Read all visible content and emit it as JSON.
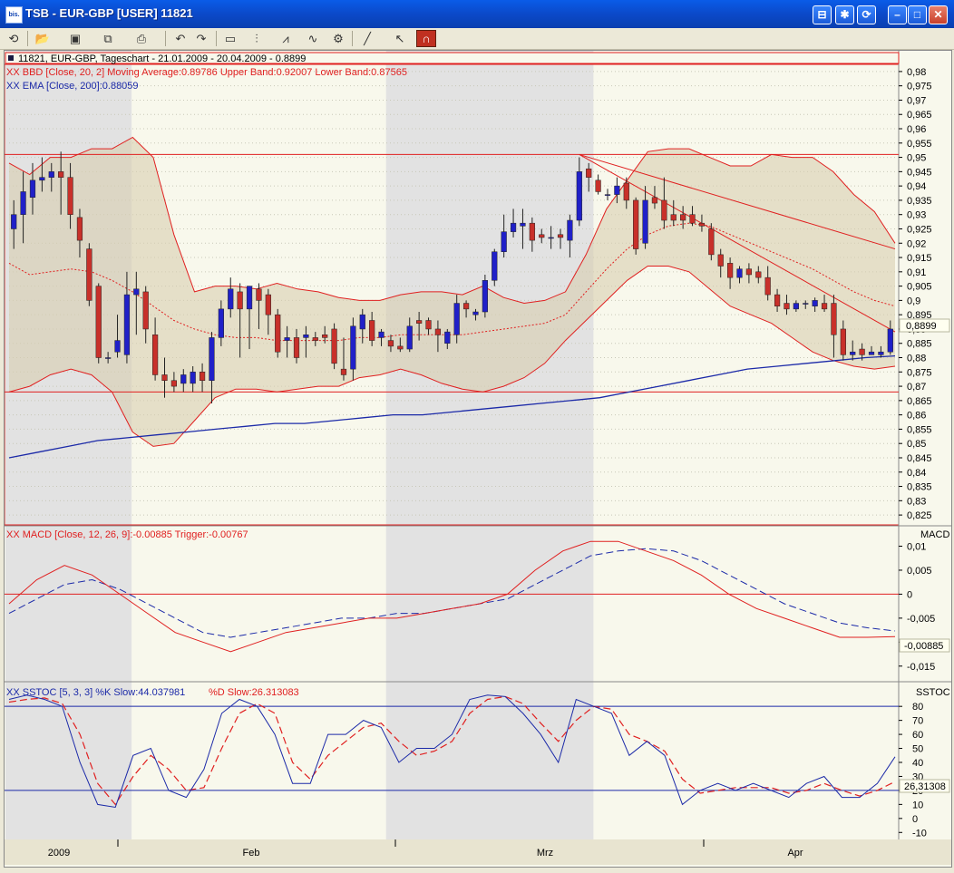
{
  "window": {
    "app_icon": "bis.",
    "title": "TSB - EUR-GBP [USER] 11821",
    "buttons": [
      "layout-icon",
      "star-icon",
      "refresh-icon",
      "minimize-icon",
      "maximize-icon",
      "close-icon"
    ]
  },
  "toolbar": {
    "tools": [
      "refresh-icon",
      "open-folder-icon",
      "save-icon",
      "copy-icon",
      "print-icon",
      "chart-back-icon",
      "chart-forward-icon",
      "window-icon",
      "candle-icon",
      "bar-style-icon",
      "indicator-icon",
      "properties-icon",
      "trendline-icon",
      "cursor-icon",
      "magnet-icon"
    ]
  },
  "colors": {
    "up_candle": "#2020c8",
    "down_candle": "#c8302a",
    "band_line": "#e02020",
    "ema_line": "#1c2aa8",
    "band_fill": "#d8ceb0",
    "shade": "#c8c8d8",
    "chart_bg": "#f8f8ec"
  },
  "price_panel": {
    "header": "11821, EUR-GBP, Tageschart - 21.01.2009 - 20.04.2009 - 0.8899",
    "legend_bbd": "XX BBD [Close, 20, 2] Moving Average:0.89786 Upper Band:0.92007 Lower Band:0.87565",
    "legend_ema": "XX EMA [Close, 200]:0.88059",
    "current_price_label": "0,8899",
    "y_ticks": [
      "0,98",
      "0,975",
      "0,97",
      "0,965",
      "0,96",
      "0,955",
      "0,95",
      "0,945",
      "0,94",
      "0,935",
      "0,93",
      "0,925",
      "0,92",
      "0,915",
      "0,91",
      "0,905",
      "0,9",
      "0,895",
      "0,89",
      "0,885",
      "0,88",
      "0,875",
      "0,87",
      "0,865",
      "0,86",
      "0,855",
      "0,85",
      "0,845",
      "0,84",
      "0,835",
      "0,83",
      "0,825"
    ]
  },
  "macd_panel": {
    "title": "MACD",
    "legend": "XX MACD [Close, 12, 26, 9]:-0.00885 Trigger:-0.00767",
    "value_label": "-0,00885",
    "y_ticks": [
      "0,01",
      "0,005",
      "0",
      "-0,005",
      "-0,01",
      "-0,015"
    ]
  },
  "sstoc_panel": {
    "title": "SSTOC",
    "legend_k": "XX SSTOC [5, 3, 3] %K Slow:44.037981",
    "legend_d": "%D Slow:26.313083",
    "value_label": "26,31308",
    "y_ticks": [
      "80",
      "70",
      "60",
      "50",
      "40",
      "30",
      "20",
      "10",
      "0",
      "-10"
    ]
  },
  "x_axis": {
    "labels": [
      "2009",
      "Feb",
      "Mrz",
      "Apr"
    ]
  },
  "chart_data": {
    "type": "candlestick",
    "symbol": "EUR-GBP",
    "period": "21.01.2009 - 20.04.2009",
    "ylim": [
      0.8225,
      0.9825
    ],
    "support_resistance": [
      0.951,
      0.868
    ],
    "candles": [
      {
        "o": 0.925,
        "h": 0.935,
        "l": 0.918,
        "c": 0.93
      },
      {
        "o": 0.93,
        "h": 0.945,
        "l": 0.92,
        "c": 0.938
      },
      {
        "o": 0.936,
        "h": 0.948,
        "l": 0.93,
        "c": 0.942
      },
      {
        "o": 0.942,
        "h": 0.95,
        "l": 0.938,
        "c": 0.943
      },
      {
        "o": 0.943,
        "h": 0.948,
        "l": 0.938,
        "c": 0.945
      },
      {
        "o": 0.945,
        "h": 0.952,
        "l": 0.93,
        "c": 0.943
      },
      {
        "o": 0.943,
        "h": 0.948,
        "l": 0.925,
        "c": 0.93
      },
      {
        "o": 0.929,
        "h": 0.932,
        "l": 0.915,
        "c": 0.921
      },
      {
        "o": 0.918,
        "h": 0.92,
        "l": 0.898,
        "c": 0.9
      },
      {
        "o": 0.905,
        "h": 0.906,
        "l": 0.878,
        "c": 0.88
      },
      {
        "o": 0.88,
        "h": 0.882,
        "l": 0.878,
        "c": 0.88
      },
      {
        "o": 0.882,
        "h": 0.895,
        "l": 0.88,
        "c": 0.886
      },
      {
        "o": 0.881,
        "h": 0.91,
        "l": 0.878,
        "c": 0.902
      },
      {
        "o": 0.902,
        "h": 0.91,
        "l": 0.888,
        "c": 0.904
      },
      {
        "o": 0.903,
        "h": 0.905,
        "l": 0.885,
        "c": 0.89
      },
      {
        "o": 0.888,
        "h": 0.894,
        "l": 0.872,
        "c": 0.874
      },
      {
        "o": 0.874,
        "h": 0.88,
        "l": 0.866,
        "c": 0.872
      },
      {
        "o": 0.872,
        "h": 0.875,
        "l": 0.868,
        "c": 0.87
      },
      {
        "o": 0.871,
        "h": 0.876,
        "l": 0.868,
        "c": 0.874
      },
      {
        "o": 0.871,
        "h": 0.877,
        "l": 0.868,
        "c": 0.875
      },
      {
        "o": 0.875,
        "h": 0.878,
        "l": 0.868,
        "c": 0.872
      },
      {
        "o": 0.872,
        "h": 0.889,
        "l": 0.864,
        "c": 0.887
      },
      {
        "o": 0.887,
        "h": 0.9,
        "l": 0.884,
        "c": 0.897
      },
      {
        "o": 0.897,
        "h": 0.908,
        "l": 0.894,
        "c": 0.904
      },
      {
        "o": 0.903,
        "h": 0.906,
        "l": 0.88,
        "c": 0.897
      },
      {
        "o": 0.897,
        "h": 0.905,
        "l": 0.883,
        "c": 0.905
      },
      {
        "o": 0.904,
        "h": 0.906,
        "l": 0.89,
        "c": 0.9
      },
      {
        "o": 0.902,
        "h": 0.904,
        "l": 0.888,
        "c": 0.895
      },
      {
        "o": 0.895,
        "h": 0.897,
        "l": 0.88,
        "c": 0.882
      },
      {
        "o": 0.886,
        "h": 0.891,
        "l": 0.88,
        "c": 0.887
      },
      {
        "o": 0.887,
        "h": 0.89,
        "l": 0.878,
        "c": 0.88
      },
      {
        "o": 0.887,
        "h": 0.891,
        "l": 0.88,
        "c": 0.888
      },
      {
        "o": 0.887,
        "h": 0.889,
        "l": 0.884,
        "c": 0.886
      },
      {
        "o": 0.888,
        "h": 0.891,
        "l": 0.885,
        "c": 0.887
      },
      {
        "o": 0.89,
        "h": 0.892,
        "l": 0.876,
        "c": 0.878
      },
      {
        "o": 0.876,
        "h": 0.887,
        "l": 0.872,
        "c": 0.874
      },
      {
        "o": 0.876,
        "h": 0.894,
        "l": 0.872,
        "c": 0.891
      },
      {
        "o": 0.89,
        "h": 0.897,
        "l": 0.885,
        "c": 0.895
      },
      {
        "o": 0.893,
        "h": 0.896,
        "l": 0.884,
        "c": 0.886
      },
      {
        "o": 0.887,
        "h": 0.89,
        "l": 0.884,
        "c": 0.889
      },
      {
        "o": 0.886,
        "h": 0.888,
        "l": 0.882,
        "c": 0.884
      },
      {
        "o": 0.884,
        "h": 0.887,
        "l": 0.882,
        "c": 0.883
      },
      {
        "o": 0.883,
        "h": 0.894,
        "l": 0.882,
        "c": 0.891
      },
      {
        "o": 0.893,
        "h": 0.896,
        "l": 0.886,
        "c": 0.892
      },
      {
        "o": 0.893,
        "h": 0.894,
        "l": 0.888,
        "c": 0.89
      },
      {
        "o": 0.89,
        "h": 0.893,
        "l": 0.882,
        "c": 0.888
      },
      {
        "o": 0.885,
        "h": 0.89,
        "l": 0.883,
        "c": 0.889
      },
      {
        "o": 0.888,
        "h": 0.902,
        "l": 0.885,
        "c": 0.899
      },
      {
        "o": 0.899,
        "h": 0.9,
        "l": 0.894,
        "c": 0.897
      },
      {
        "o": 0.895,
        "h": 0.897,
        "l": 0.893,
        "c": 0.896
      },
      {
        "o": 0.896,
        "h": 0.909,
        "l": 0.894,
        "c": 0.907
      },
      {
        "o": 0.907,
        "h": 0.918,
        "l": 0.905,
        "c": 0.917
      },
      {
        "o": 0.917,
        "h": 0.93,
        "l": 0.915,
        "c": 0.924
      },
      {
        "o": 0.924,
        "h": 0.932,
        "l": 0.922,
        "c": 0.927
      },
      {
        "o": 0.926,
        "h": 0.932,
        "l": 0.918,
        "c": 0.927
      },
      {
        "o": 0.927,
        "h": 0.929,
        "l": 0.917,
        "c": 0.921
      },
      {
        "o": 0.923,
        "h": 0.925,
        "l": 0.92,
        "c": 0.922
      },
      {
        "o": 0.922,
        "h": 0.926,
        "l": 0.918,
        "c": 0.922
      },
      {
        "o": 0.923,
        "h": 0.925,
        "l": 0.918,
        "c": 0.922
      },
      {
        "o": 0.921,
        "h": 0.93,
        "l": 0.915,
        "c": 0.928
      },
      {
        "o": 0.928,
        "h": 0.95,
        "l": 0.926,
        "c": 0.945
      },
      {
        "o": 0.946,
        "h": 0.948,
        "l": 0.938,
        "c": 0.943
      },
      {
        "o": 0.942,
        "h": 0.944,
        "l": 0.937,
        "c": 0.938
      },
      {
        "o": 0.937,
        "h": 0.939,
        "l": 0.935,
        "c": 0.937
      },
      {
        "o": 0.937,
        "h": 0.943,
        "l": 0.934,
        "c": 0.94
      },
      {
        "o": 0.941,
        "h": 0.943,
        "l": 0.932,
        "c": 0.935
      },
      {
        "o": 0.935,
        "h": 0.936,
        "l": 0.916,
        "c": 0.918
      },
      {
        "o": 0.92,
        "h": 0.94,
        "l": 0.918,
        "c": 0.935
      },
      {
        "o": 0.936,
        "h": 0.94,
        "l": 0.932,
        "c": 0.934
      },
      {
        "o": 0.935,
        "h": 0.943,
        "l": 0.925,
        "c": 0.928
      },
      {
        "o": 0.93,
        "h": 0.935,
        "l": 0.926,
        "c": 0.928
      },
      {
        "o": 0.93,
        "h": 0.933,
        "l": 0.925,
        "c": 0.928
      },
      {
        "o": 0.93,
        "h": 0.933,
        "l": 0.926,
        "c": 0.927
      },
      {
        "o": 0.927,
        "h": 0.93,
        "l": 0.924,
        "c": 0.926
      },
      {
        "o": 0.925,
        "h": 0.927,
        "l": 0.914,
        "c": 0.916
      },
      {
        "o": 0.916,
        "h": 0.918,
        "l": 0.908,
        "c": 0.912
      },
      {
        "o": 0.913,
        "h": 0.915,
        "l": 0.904,
        "c": 0.908
      },
      {
        "o": 0.908,
        "h": 0.912,
        "l": 0.906,
        "c": 0.911
      },
      {
        "o": 0.911,
        "h": 0.913,
        "l": 0.906,
        "c": 0.909
      },
      {
        "o": 0.91,
        "h": 0.912,
        "l": 0.906,
        "c": 0.908
      },
      {
        "o": 0.908,
        "h": 0.912,
        "l": 0.9,
        "c": 0.902
      },
      {
        "o": 0.902,
        "h": 0.904,
        "l": 0.896,
        "c": 0.898
      },
      {
        "o": 0.899,
        "h": 0.902,
        "l": 0.895,
        "c": 0.897
      },
      {
        "o": 0.897,
        "h": 0.9,
        "l": 0.896,
        "c": 0.899
      },
      {
        "o": 0.899,
        "h": 0.9,
        "l": 0.897,
        "c": 0.899
      },
      {
        "o": 0.898,
        "h": 0.901,
        "l": 0.896,
        "c": 0.9
      },
      {
        "o": 0.899,
        "h": 0.902,
        "l": 0.896,
        "c": 0.897
      },
      {
        "o": 0.899,
        "h": 0.902,
        "l": 0.88,
        "c": 0.888
      },
      {
        "o": 0.89,
        "h": 0.893,
        "l": 0.879,
        "c": 0.881
      },
      {
        "o": 0.881,
        "h": 0.886,
        "l": 0.879,
        "c": 0.882
      },
      {
        "o": 0.883,
        "h": 0.885,
        "l": 0.879,
        "c": 0.881
      },
      {
        "o": 0.881,
        "h": 0.884,
        "l": 0.881,
        "c": 0.882
      },
      {
        "o": 0.881,
        "h": 0.884,
        "l": 0.88,
        "c": 0.882
      },
      {
        "o": 0.882,
        "h": 0.893,
        "l": 0.881,
        "c": 0.89
      }
    ],
    "ema_200": [
      0.845,
      0.847,
      0.849,
      0.851,
      0.852,
      0.853,
      0.854,
      0.855,
      0.856,
      0.857,
      0.857,
      0.858,
      0.859,
      0.86,
      0.86,
      0.861,
      0.862,
      0.863,
      0.864,
      0.865,
      0.866,
      0.868,
      0.87,
      0.872,
      0.874,
      0.876,
      0.877,
      0.878,
      0.879,
      0.88,
      0.8806
    ],
    "bbd_upper": [
      0.948,
      0.944,
      0.95,
      0.95,
      0.953,
      0.953,
      0.957,
      0.95,
      0.923,
      0.903,
      0.905,
      0.905,
      0.904,
      0.906,
      0.904,
      0.903,
      0.901,
      0.9,
      0.9,
      0.902,
      0.903,
      0.903,
      0.902,
      0.905,
      0.901,
      0.899,
      0.9,
      0.903,
      0.916,
      0.932,
      0.942,
      0.952,
      0.953,
      0.953,
      0.95,
      0.947,
      0.947,
      0.951,
      0.95,
      0.95,
      0.945,
      0.937,
      0.931,
      0.92
    ],
    "bbd_lower": [
      0.868,
      0.87,
      0.874,
      0.876,
      0.874,
      0.868,
      0.854,
      0.849,
      0.85,
      0.858,
      0.866,
      0.869,
      0.869,
      0.868,
      0.869,
      0.87,
      0.87,
      0.873,
      0.874,
      0.876,
      0.874,
      0.871,
      0.869,
      0.868,
      0.87,
      0.873,
      0.878,
      0.886,
      0.893,
      0.9,
      0.907,
      0.912,
      0.912,
      0.91,
      0.904,
      0.898,
      0.895,
      0.892,
      0.887,
      0.882,
      0.879,
      0.877,
      0.876,
      0.877
    ],
    "bbd_ma": [
      0.913,
      0.909,
      0.91,
      0.911,
      0.91,
      0.907,
      0.903,
      0.898,
      0.893,
      0.89,
      0.888,
      0.887,
      0.887,
      0.886,
      0.886,
      0.886,
      0.886,
      0.887,
      0.887,
      0.888,
      0.888,
      0.888,
      0.888,
      0.889,
      0.89,
      0.891,
      0.892,
      0.895,
      0.903,
      0.911,
      0.918,
      0.923,
      0.926,
      0.927,
      0.926,
      0.923,
      0.92,
      0.917,
      0.914,
      0.911,
      0.907,
      0.903,
      0.9,
      0.898
    ],
    "macd": [
      -0.002,
      0.003,
      0.006,
      0.004,
      0.0,
      -0.004,
      -0.008,
      -0.01,
      -0.012,
      -0.01,
      -0.008,
      -0.007,
      -0.006,
      -0.005,
      -0.005,
      -0.004,
      -0.003,
      -0.002,
      0.0,
      0.005,
      0.009,
      0.011,
      0.011,
      0.009,
      0.007,
      0.004,
      0.0,
      -0.003,
      -0.005,
      -0.007,
      -0.009,
      -0.009,
      -0.00885
    ],
    "macd_trigger": [
      -0.004,
      -0.001,
      0.002,
      0.003,
      0.001,
      -0.002,
      -0.005,
      -0.008,
      -0.009,
      -0.008,
      -0.007,
      -0.006,
      -0.005,
      -0.005,
      -0.004,
      -0.004,
      -0.003,
      -0.002,
      -0.001,
      0.002,
      0.005,
      0.008,
      0.009,
      0.0095,
      0.009,
      0.007,
      0.004,
      0.001,
      -0.002,
      -0.004,
      -0.006,
      -0.007,
      -0.00767
    ],
    "sstoc_k": [
      85,
      88,
      85,
      80,
      40,
      10,
      8,
      45,
      50,
      20,
      15,
      35,
      75,
      85,
      80,
      60,
      25,
      25,
      60,
      60,
      70,
      65,
      40,
      50,
      50,
      60,
      85,
      88,
      87,
      75,
      60,
      40,
      85,
      80,
      75,
      45,
      55,
      45,
      10,
      20,
      25,
      20,
      25,
      20,
      15,
      25,
      30,
      15,
      15,
      25,
      44
    ],
    "sstoc_d": [
      83,
      85,
      86,
      82,
      60,
      25,
      10,
      30,
      45,
      35,
      20,
      22,
      50,
      75,
      82,
      75,
      40,
      28,
      45,
      55,
      65,
      68,
      55,
      45,
      48,
      55,
      75,
      85,
      87,
      82,
      68,
      55,
      70,
      80,
      78,
      60,
      55,
      48,
      28,
      18,
      20,
      22,
      22,
      22,
      18,
      20,
      25,
      20,
      16,
      20,
      26.31
    ]
  }
}
